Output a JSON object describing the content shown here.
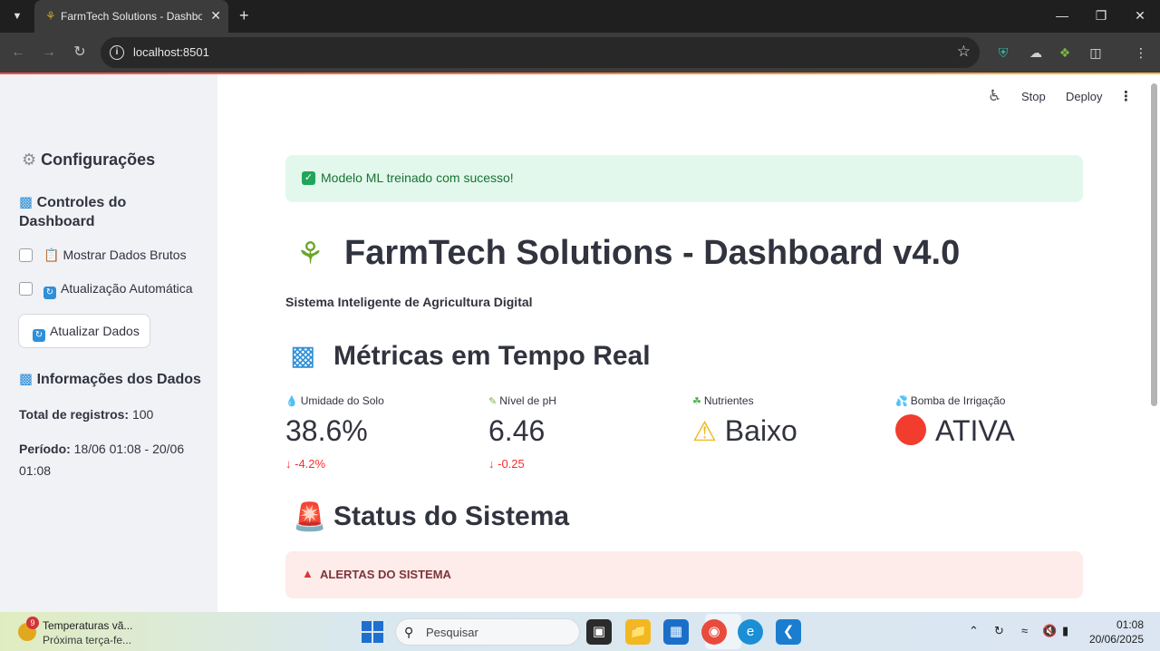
{
  "browser": {
    "tab_title": "FarmTech Solutions - Dashboard",
    "url": "localhost:8501"
  },
  "app_header": {
    "stop": "Stop",
    "deploy": "Deploy"
  },
  "sidebar": {
    "settings_title": "Configurações",
    "controls_title": "Controles do Dashboard",
    "show_raw": "Mostrar Dados Brutos",
    "auto_update": "Atualização Automática",
    "update_button": "Atualizar Dados",
    "info_title": "Informações dos Dados",
    "total_label": "Total de registros:",
    "total_value": "100",
    "period_label": "Período:",
    "period_value": "18/06 01:08 - 20/06 01:08"
  },
  "main": {
    "success_message": "Modelo ML treinado com sucesso!",
    "title": "FarmTech Solutions - Dashboard v4.0",
    "subtitle": "Sistema Inteligente de Agricultura Digital",
    "metrics_title": "Métricas em Tempo Real",
    "metrics": [
      {
        "label": "Umidade do Solo",
        "value": "38.6%",
        "delta": "-4.2%"
      },
      {
        "label": "Nível de pH",
        "value": "6.46",
        "delta": "-0.25"
      },
      {
        "label": "Nutrientes",
        "value": "Baixo",
        "delta": ""
      },
      {
        "label": "Bomba de Irrigação",
        "value": "ATIVA",
        "delta": ""
      }
    ],
    "status_title": "Status do Sistema",
    "alerts_title": "ALERTAS DO SISTEMA"
  },
  "taskbar": {
    "weather_badge": "9",
    "weather_line1": "Temperaturas vã...",
    "weather_line2": "Próxima terça-fe...",
    "search_placeholder": "Pesquisar",
    "time": "01:08",
    "date": "20/06/2025"
  },
  "colors": {
    "success_bg": "#e3f8ec",
    "success_text": "#177233",
    "error_bg": "#fdecea",
    "delta_negative": "#ff2b2b",
    "sidebar_bg": "#f0f2f6"
  }
}
